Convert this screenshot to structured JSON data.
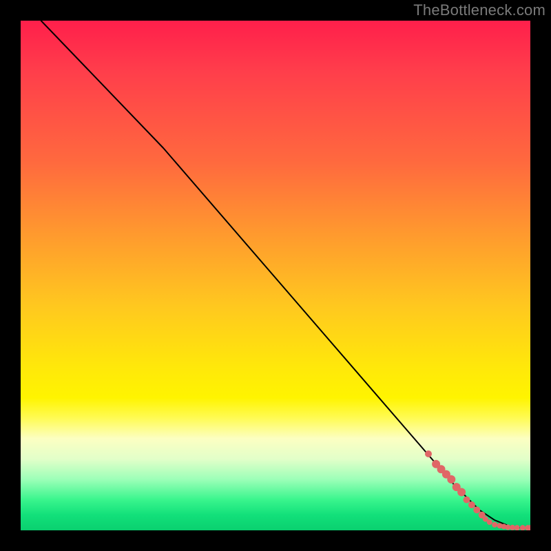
{
  "watermark": "TheBottleneck.com",
  "chart_data": {
    "type": "line",
    "title": "",
    "xlabel": "",
    "ylabel": "",
    "xlim": [
      0,
      100
    ],
    "ylim": [
      0,
      100
    ],
    "series": [
      {
        "name": "curve",
        "x": [
          4,
          28,
          85,
          90,
          93,
          95,
          96,
          97,
          98,
          99,
          100
        ],
        "values": [
          100,
          75,
          9,
          4,
          2,
          1.2,
          0.8,
          0.6,
          0.5,
          0.4,
          0.4
        ]
      }
    ],
    "scatter": {
      "name": "points",
      "color": "#e06666",
      "points": [
        {
          "x": 80,
          "y": 15,
          "r": 5
        },
        {
          "x": 81.5,
          "y": 13,
          "r": 6
        },
        {
          "x": 82.5,
          "y": 12,
          "r": 6
        },
        {
          "x": 83.5,
          "y": 11,
          "r": 6
        },
        {
          "x": 84.5,
          "y": 10,
          "r": 6
        },
        {
          "x": 85.5,
          "y": 8.5,
          "r": 6
        },
        {
          "x": 86.5,
          "y": 7.5,
          "r": 6
        },
        {
          "x": 87.5,
          "y": 6,
          "r": 5
        },
        {
          "x": 88.5,
          "y": 5,
          "r": 5
        },
        {
          "x": 89.5,
          "y": 4,
          "r": 5
        },
        {
          "x": 90.5,
          "y": 3,
          "r": 5
        },
        {
          "x": 91.2,
          "y": 2.2,
          "r": 4
        },
        {
          "x": 92,
          "y": 1.6,
          "r": 4
        },
        {
          "x": 93,
          "y": 1.1,
          "r": 4
        },
        {
          "x": 94,
          "y": 0.9,
          "r": 4
        },
        {
          "x": 94.8,
          "y": 0.75,
          "r": 4
        },
        {
          "x": 95.6,
          "y": 0.6,
          "r": 4
        },
        {
          "x": 96.5,
          "y": 0.55,
          "r": 4
        },
        {
          "x": 97.4,
          "y": 0.5,
          "r": 4
        },
        {
          "x": 98.5,
          "y": 0.5,
          "r": 4
        },
        {
          "x": 99.5,
          "y": 0.5,
          "r": 4
        },
        {
          "x": 100,
          "y": 0.5,
          "r": 4
        }
      ]
    },
    "gradient_stops": [
      {
        "pos": 0,
        "color": "#ff1f4b"
      },
      {
        "pos": 28,
        "color": "#ff6a3e"
      },
      {
        "pos": 56,
        "color": "#ffc81f"
      },
      {
        "pos": 74,
        "color": "#fff400"
      },
      {
        "pos": 90,
        "color": "#9cffb8"
      },
      {
        "pos": 100,
        "color": "#0ad06f"
      }
    ]
  }
}
